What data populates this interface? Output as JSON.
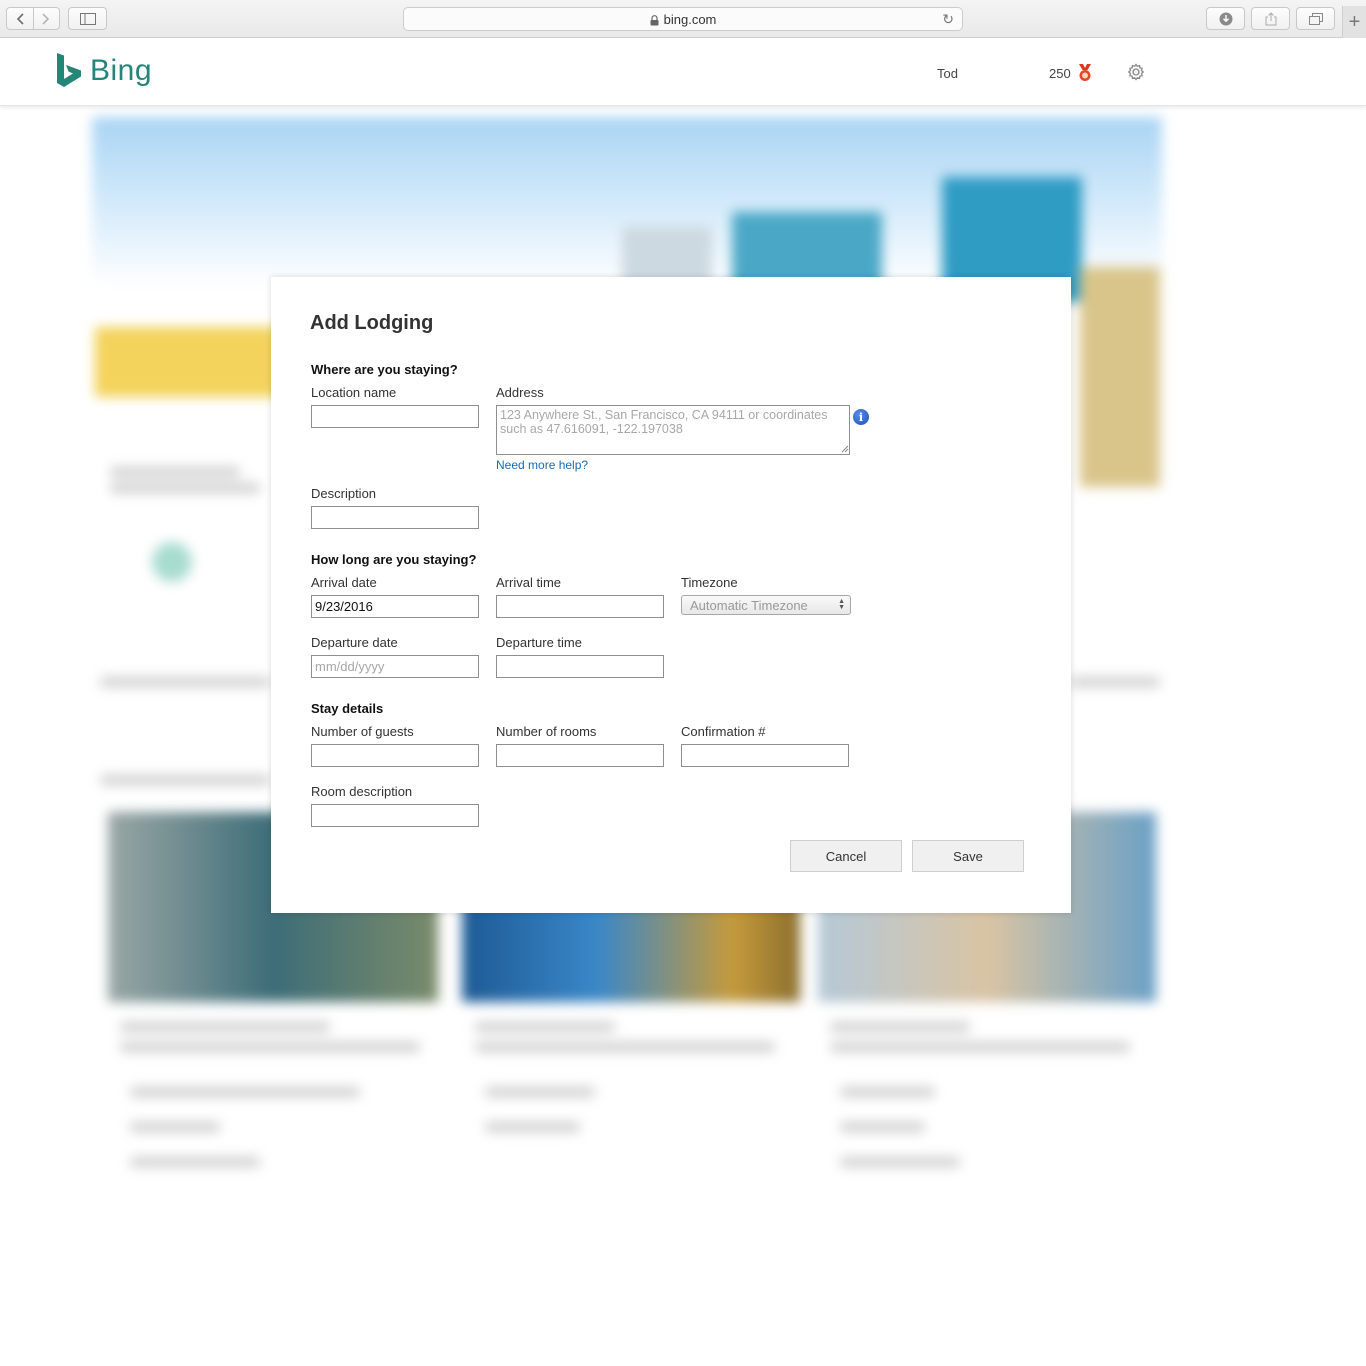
{
  "browser": {
    "url": "bing.com"
  },
  "header": {
    "logo_text": "Bing",
    "user_name": "Tod",
    "points": "250",
    "brand_color": "#258577"
  },
  "modal": {
    "title": "Add Lodging",
    "section_where": "Where are you staying?",
    "location_name_label": "Location name",
    "location_name_value": "",
    "address_label": "Address",
    "address_placeholder": "123 Anywhere St., San Francisco, CA 94111 or coordinates such as 47.616091, -122.197038",
    "help_link": "Need more help?",
    "description_label": "Description",
    "description_value": "",
    "section_howlong": "How long are you staying?",
    "arrival_date_label": "Arrival date",
    "arrival_date_value": "9/23/2016",
    "arrival_time_label": "Arrival time",
    "timezone_label": "Timezone",
    "timezone_value": "Automatic Timezone",
    "departure_date_label": "Departure date",
    "departure_date_placeholder": "mm/dd/yyyy",
    "departure_time_label": "Departure time",
    "section_details": "Stay details",
    "guests_label": "Number of guests",
    "rooms_label": "Number of rooms",
    "confirmation_label": "Confirmation #",
    "room_description_label": "Room description",
    "cancel_label": "Cancel",
    "save_label": "Save",
    "link_color": "#1a6bb8"
  }
}
